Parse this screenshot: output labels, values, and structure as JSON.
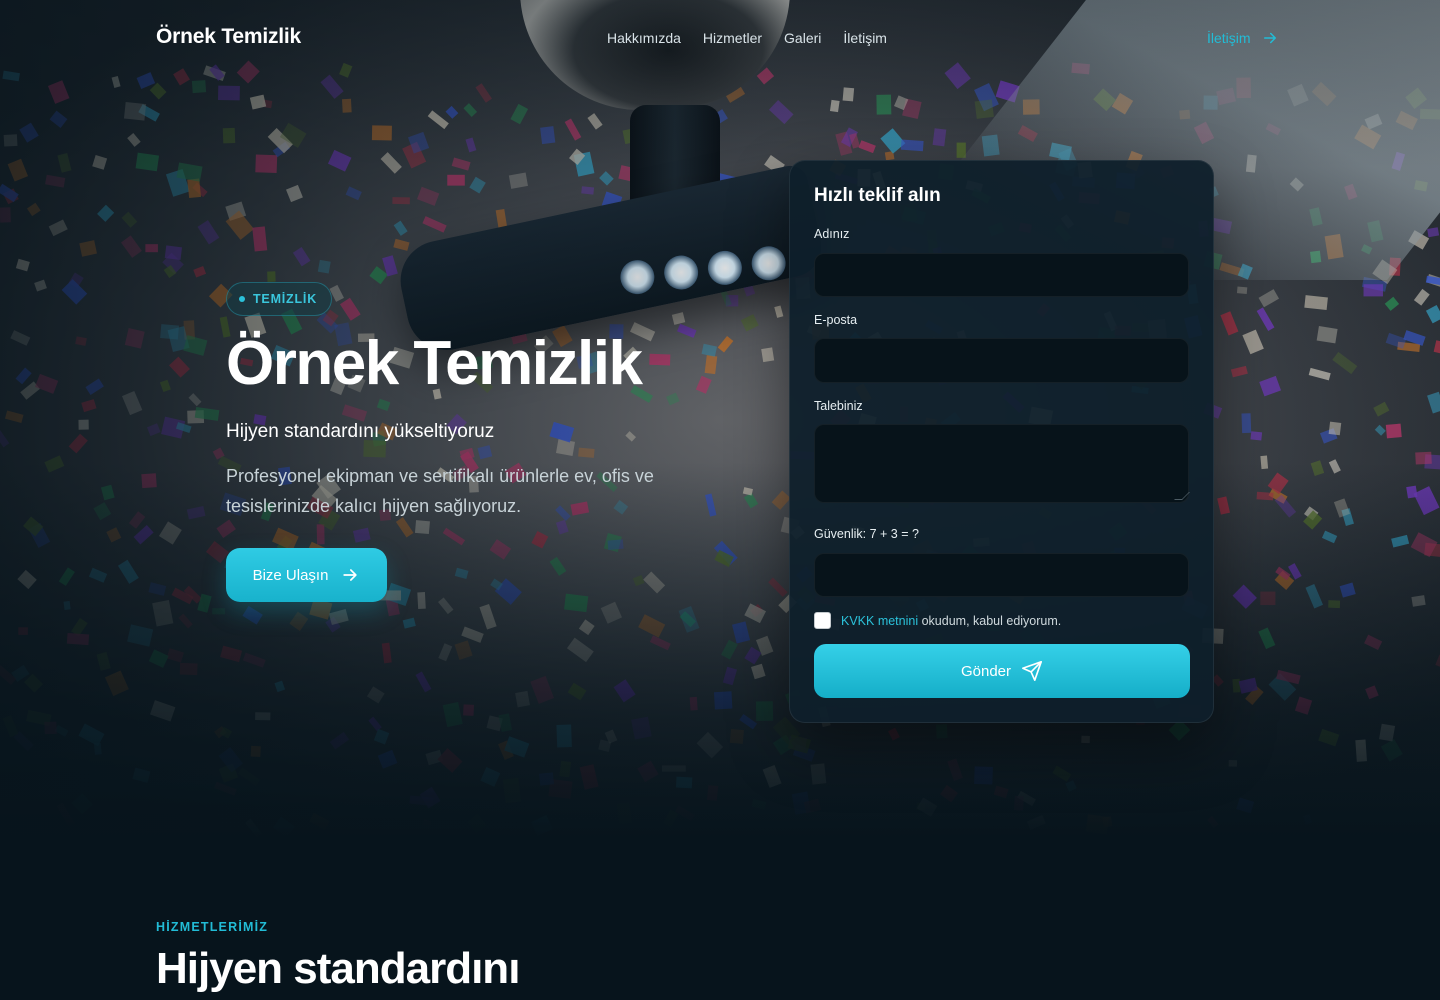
{
  "nav": {
    "brand": "Örnek Temizlik",
    "links": [
      "Hakkımızda",
      "Hizmetler",
      "Galeri",
      "İletişim"
    ],
    "cta_label": "İletişim"
  },
  "hero": {
    "badge": "TEMİZLİK",
    "title": "Örnek Temizlik",
    "subtitle": "Hijyen standardını yükseltiyoruz",
    "description": "Profesyonel ekipman ve sertifikalı ürünlerle ev, ofis ve tesislerinizde kalıcı hijyen sağlıyoruz.",
    "button_label": "Bize Ulaşın"
  },
  "form": {
    "title": "Hızlı teklif alın",
    "name_label": "Adınız",
    "name_value": "",
    "email_label": "E-posta",
    "email_value": "",
    "request_label": "Talebiniz",
    "request_value": "",
    "captcha_label": "Güvenlik: 7 + 3 = ?",
    "captcha_value": "",
    "kvkk_link": "KVKK metnini",
    "kvkk_text": "okudum, kabul ediyorum.",
    "kvkk_checked": false,
    "submit_label": "Gönder"
  },
  "services": {
    "eyebrow": "HİZMETLERİMİZ",
    "title": "Hijyen standardını"
  },
  "colors": {
    "accent": "#22bcd6",
    "background": "#07141c",
    "card": "#0e1f2a"
  },
  "icons": {
    "nav_cta": "arrow-right-icon",
    "hero_button": "arrow-right-icon",
    "submit": "send-icon"
  }
}
